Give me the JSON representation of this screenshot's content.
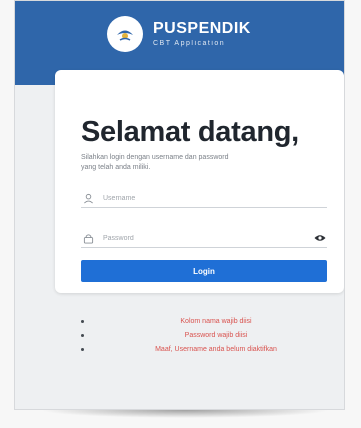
{
  "brand": {
    "title": "PUSPENDIK",
    "subtitle": "CBT Application",
    "logo_icon": "tut-wuri-logo-icon"
  },
  "login": {
    "heading": "Selamat datang,",
    "subtitle": "Silahkan login dengan username dan password yang telah anda miliki.",
    "username_placeholder": "Username",
    "password_placeholder": "Password",
    "submit_label": "Login"
  },
  "errors": [
    "Kolom nama wajib diisi",
    "Password wajib diisi",
    "Maaf, Username anda belum diaktifkan"
  ],
  "colors": {
    "header": "#2f66aa",
    "button": "#1f6fd6",
    "error": "#d9534f"
  }
}
